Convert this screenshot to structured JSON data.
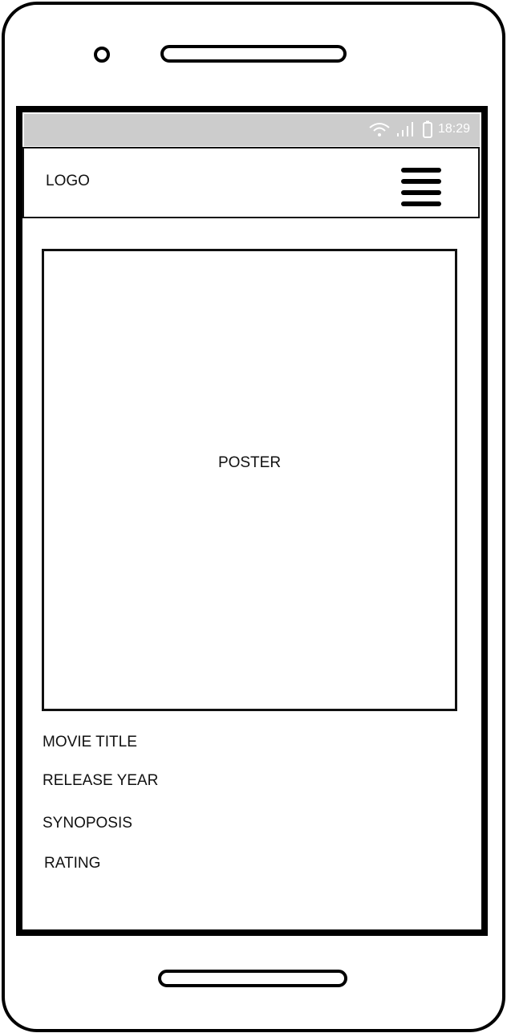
{
  "status_bar": {
    "time": "18:29",
    "icons": [
      "wifi-icon",
      "signal-icon",
      "battery-icon"
    ]
  },
  "header": {
    "logo": "LOGO",
    "menu_icon": "hamburger-icon"
  },
  "poster": {
    "label": "POSTER"
  },
  "details": {
    "title": "MOVIE TITLE",
    "release_year": "RELEASE YEAR",
    "synopsis": "SYNOPOSIS",
    "rating": "RATING"
  }
}
